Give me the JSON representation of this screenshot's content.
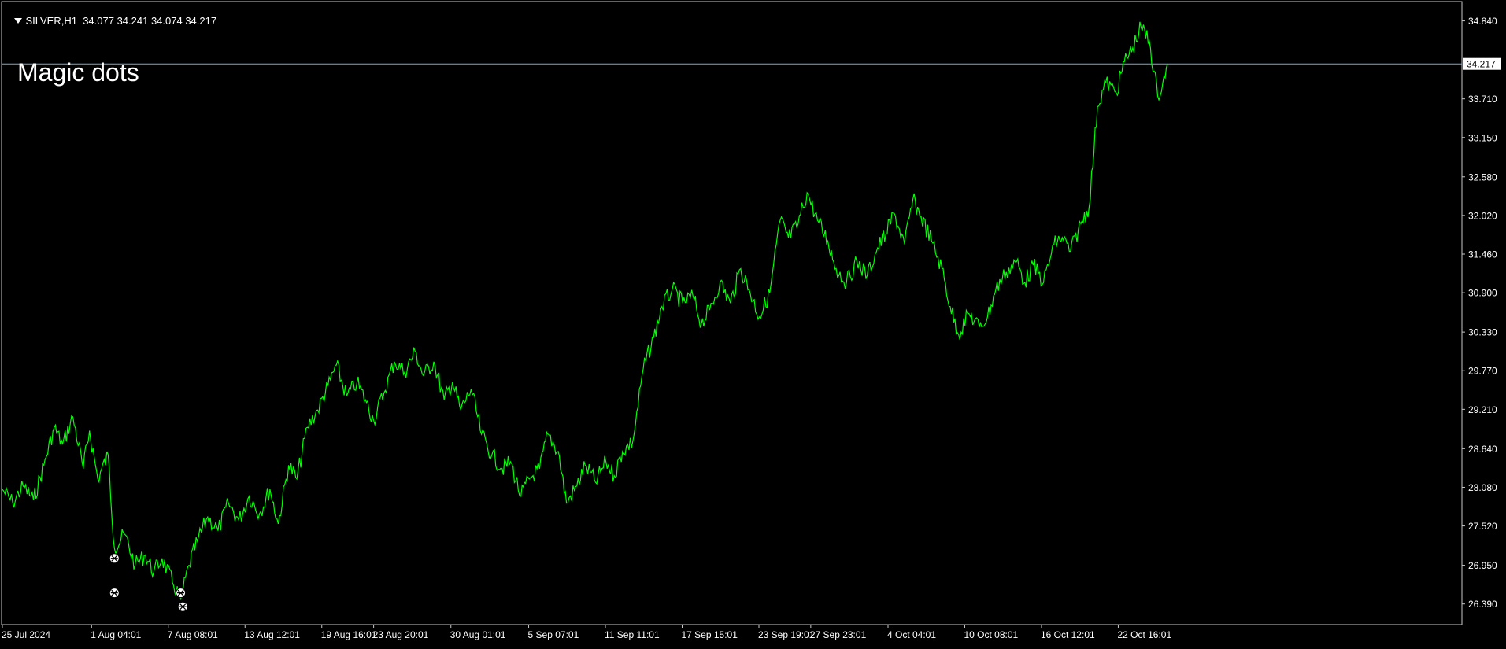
{
  "header": {
    "symbol": "SILVER,H1",
    "ohlc": "34.077 34.241 34.074 34.217"
  },
  "indicator_label": "Magic dots",
  "colors": {
    "background": "#000000",
    "frame": "#c8c8c8",
    "price_line": "#00ff00",
    "current_line": "#7fa7c9",
    "text": "#ffffff",
    "dot_fill": "#ffffff",
    "dot_mark": "#000000"
  },
  "chart_data": {
    "type": "line",
    "ylim": [
      26.09,
      35.12
    ],
    "yticks": [
      34.84,
      33.71,
      33.15,
      32.58,
      32.02,
      31.46,
      30.9,
      30.33,
      29.77,
      29.21,
      28.64,
      28.08,
      27.52,
      26.95,
      26.39
    ],
    "ytick_labels": [
      "34.840",
      "33.710",
      "33.150",
      "32.580",
      "32.020",
      "31.460",
      "30.900",
      "30.330",
      "29.770",
      "29.210",
      "28.640",
      "28.080",
      "27.520",
      "26.950",
      "26.390"
    ],
    "current_price": 34.217,
    "current_price_label": "34.217",
    "x_range": [
      "2024-07-25 00:00",
      "2024-10-26 15:00"
    ],
    "x_ticks": [
      {
        "t": "2024-07-25 00:00",
        "label": "25 Jul 2024"
      },
      {
        "t": "2024-08-01 04:01",
        "label": "1 Aug 04:01"
      },
      {
        "t": "2024-08-07 08:01",
        "label": "7 Aug 08:01"
      },
      {
        "t": "2024-08-13 12:01",
        "label": "13 Aug 12:01"
      },
      {
        "t": "2024-08-19 16:01",
        "label": "19 Aug 16:01"
      },
      {
        "t": "2024-08-23 20:01",
        "label": "23 Aug 20:01"
      },
      {
        "t": "2024-08-30 01:01",
        "label": "30 Aug 01:01"
      },
      {
        "t": "2024-09-05 07:01",
        "label": "5 Sep 07:01"
      },
      {
        "t": "2024-09-11 11:01",
        "label": "11 Sep 11:01"
      },
      {
        "t": "2024-09-17 15:01",
        "label": "17 Sep 15:01"
      },
      {
        "t": "2024-09-23 19:01",
        "label": "23 Sep 19:01"
      },
      {
        "t": "2024-09-27 23:01",
        "label": "27 Sep 23:01"
      },
      {
        "t": "2024-10-04 04:01",
        "label": "4 Oct 04:01"
      },
      {
        "t": "2024-10-10 08:01",
        "label": "10 Oct 08:01"
      },
      {
        "t": "2024-10-16 12:01",
        "label": "16 Oct 12:01"
      },
      {
        "t": "2024-10-22 16:01",
        "label": "22 Oct 16:01"
      }
    ],
    "series": [
      {
        "values": [
          [
            "2024-07-25 00:00",
            28.05
          ],
          [
            "2024-07-25 20:00",
            27.85
          ],
          [
            "2024-07-26 16:00",
            28.1
          ],
          [
            "2024-07-27 12:00",
            27.9
          ],
          [
            "2024-07-28 08:00",
            28.4
          ],
          [
            "2024-07-29 04:00",
            28.95
          ],
          [
            "2024-07-29 20:00",
            28.7
          ],
          [
            "2024-07-30 16:00",
            29.1
          ],
          [
            "2024-07-31 12:00",
            28.35
          ],
          [
            "2024-08-01 00:00",
            28.9
          ],
          [
            "2024-08-01 16:00",
            28.2
          ],
          [
            "2024-08-02 12:00",
            28.55
          ],
          [
            "2024-08-03 00:00",
            27.2
          ],
          [
            "2024-08-03 20:00",
            27.4
          ],
          [
            "2024-08-04 16:00",
            26.95
          ],
          [
            "2024-08-05 12:00",
            27.1
          ],
          [
            "2024-08-06 04:00",
            26.85
          ],
          [
            "2024-08-06 20:00",
            27.05
          ],
          [
            "2024-08-07 16:00",
            26.7
          ],
          [
            "2024-08-08 08:00",
            26.45
          ],
          [
            "2024-08-09 00:00",
            26.95
          ],
          [
            "2024-08-09 16:00",
            27.3
          ],
          [
            "2024-08-10 12:00",
            27.65
          ],
          [
            "2024-08-11 08:00",
            27.45
          ],
          [
            "2024-08-12 04:00",
            27.85
          ],
          [
            "2024-08-13 00:00",
            27.6
          ],
          [
            "2024-08-13 20:00",
            27.95
          ],
          [
            "2024-08-14 16:00",
            27.7
          ],
          [
            "2024-08-15 12:00",
            28.05
          ],
          [
            "2024-08-16 04:00",
            27.55
          ],
          [
            "2024-08-17 00:00",
            28.4
          ],
          [
            "2024-08-17 16:00",
            28.2
          ],
          [
            "2024-08-18 12:00",
            28.95
          ],
          [
            "2024-08-19 08:00",
            29.2
          ],
          [
            "2024-08-20 04:00",
            29.55
          ],
          [
            "2024-08-20 20:00",
            29.85
          ],
          [
            "2024-08-21 16:00",
            29.4
          ],
          [
            "2024-08-22 12:00",
            29.6
          ],
          [
            "2024-08-23 04:00",
            29.35
          ],
          [
            "2024-08-23 20:00",
            29.05
          ],
          [
            "2024-08-24 16:00",
            29.45
          ],
          [
            "2024-08-25 12:00",
            29.9
          ],
          [
            "2024-08-26 08:00",
            29.75
          ],
          [
            "2024-08-27 04:00",
            30.05
          ],
          [
            "2024-08-27 20:00",
            29.7
          ],
          [
            "2024-08-28 16:00",
            29.9
          ],
          [
            "2024-08-29 12:00",
            29.35
          ],
          [
            "2024-08-30 04:00",
            29.6
          ],
          [
            "2024-08-30 20:00",
            29.2
          ],
          [
            "2024-08-31 16:00",
            29.5
          ],
          [
            "2024-09-01 12:00",
            28.85
          ],
          [
            "2024-09-02 08:00",
            28.55
          ],
          [
            "2024-09-03 04:00",
            28.35
          ],
          [
            "2024-09-03 20:00",
            28.45
          ],
          [
            "2024-09-04 16:00",
            27.95
          ],
          [
            "2024-09-05 08:00",
            28.2
          ],
          [
            "2024-09-06 04:00",
            28.35
          ],
          [
            "2024-09-06 20:00",
            28.85
          ],
          [
            "2024-09-07 16:00",
            28.6
          ],
          [
            "2024-09-08 08:00",
            27.85
          ],
          [
            "2024-09-09 04:00",
            28.1
          ],
          [
            "2024-09-09 20:00",
            28.4
          ],
          [
            "2024-09-10 16:00",
            28.15
          ],
          [
            "2024-09-11 12:00",
            28.45
          ],
          [
            "2024-09-12 04:00",
            28.25
          ],
          [
            "2024-09-12 20:00",
            28.6
          ],
          [
            "2024-09-13 16:00",
            28.75
          ],
          [
            "2024-09-14 12:00",
            29.8
          ],
          [
            "2024-09-15 08:00",
            30.25
          ],
          [
            "2024-09-16 00:00",
            30.7
          ],
          [
            "2024-09-16 20:00",
            30.95
          ],
          [
            "2024-09-17 16:00",
            30.75
          ],
          [
            "2024-09-18 12:00",
            30.85
          ],
          [
            "2024-09-19 04:00",
            30.45
          ],
          [
            "2024-09-19 20:00",
            30.65
          ],
          [
            "2024-09-20 16:00",
            31.05
          ],
          [
            "2024-09-21 12:00",
            30.75
          ],
          [
            "2024-09-22 08:00",
            31.25
          ],
          [
            "2024-09-23 00:00",
            30.95
          ],
          [
            "2024-09-23 20:00",
            30.55
          ],
          [
            "2024-09-24 16:00",
            30.9
          ],
          [
            "2024-09-25 12:00",
            31.95
          ],
          [
            "2024-09-26 04:00",
            31.7
          ],
          [
            "2024-09-26 20:00",
            31.85
          ],
          [
            "2024-09-27 16:00",
            32.35
          ],
          [
            "2024-09-28 12:00",
            31.95
          ],
          [
            "2024-09-29 08:00",
            31.65
          ],
          [
            "2024-09-30 00:00",
            31.25
          ],
          [
            "2024-09-30 20:00",
            31.05
          ],
          [
            "2024-10-01 16:00",
            31.35
          ],
          [
            "2024-10-02 12:00",
            31.15
          ],
          [
            "2024-10-03 08:00",
            31.55
          ],
          [
            "2024-10-04 00:00",
            31.75
          ],
          [
            "2024-10-04 16:00",
            32.05
          ],
          [
            "2024-10-05 12:00",
            31.6
          ],
          [
            "2024-10-06 04:00",
            32.25
          ],
          [
            "2024-10-06 20:00",
            32.0
          ],
          [
            "2024-10-07 16:00",
            31.65
          ],
          [
            "2024-10-08 12:00",
            31.25
          ],
          [
            "2024-10-09 04:00",
            30.7
          ],
          [
            "2024-10-09 20:00",
            30.3
          ],
          [
            "2024-10-10 16:00",
            30.6
          ],
          [
            "2024-10-11 12:00",
            30.4
          ],
          [
            "2024-10-12 04:00",
            30.55
          ],
          [
            "2024-10-12 20:00",
            30.95
          ],
          [
            "2024-10-13 16:00",
            31.2
          ],
          [
            "2024-10-14 12:00",
            31.35
          ],
          [
            "2024-10-15 04:00",
            31.05
          ],
          [
            "2024-10-15 20:00",
            31.3
          ],
          [
            "2024-10-16 16:00",
            31.05
          ],
          [
            "2024-10-17 12:00",
            31.6
          ],
          [
            "2024-10-18 04:00",
            31.7
          ],
          [
            "2024-10-18 20:00",
            31.5
          ],
          [
            "2024-10-19 16:00",
            31.9
          ],
          [
            "2024-10-20 08:00",
            32.15
          ],
          [
            "2024-10-21 00:00",
            33.6
          ],
          [
            "2024-10-21 16:00",
            33.95
          ],
          [
            "2024-10-22 12:00",
            33.8
          ],
          [
            "2024-10-23 04:00",
            34.25
          ],
          [
            "2024-10-23 20:00",
            34.45
          ],
          [
            "2024-10-24 12:00",
            34.75
          ],
          [
            "2024-10-25 04:00",
            34.55
          ],
          [
            "2024-10-25 20:00",
            33.75
          ],
          [
            "2024-10-26 06:00",
            33.95
          ],
          [
            "2024-10-26 15:00",
            34.217
          ]
        ]
      }
    ],
    "markers": [
      {
        "t": "2024-08-03 00:00",
        "y": 27.05
      },
      {
        "t": "2024-08-03 00:00",
        "y": 26.55
      },
      {
        "t": "2024-08-08 08:00",
        "y": 26.55
      },
      {
        "t": "2024-08-08 12:00",
        "y": 26.35
      }
    ]
  }
}
